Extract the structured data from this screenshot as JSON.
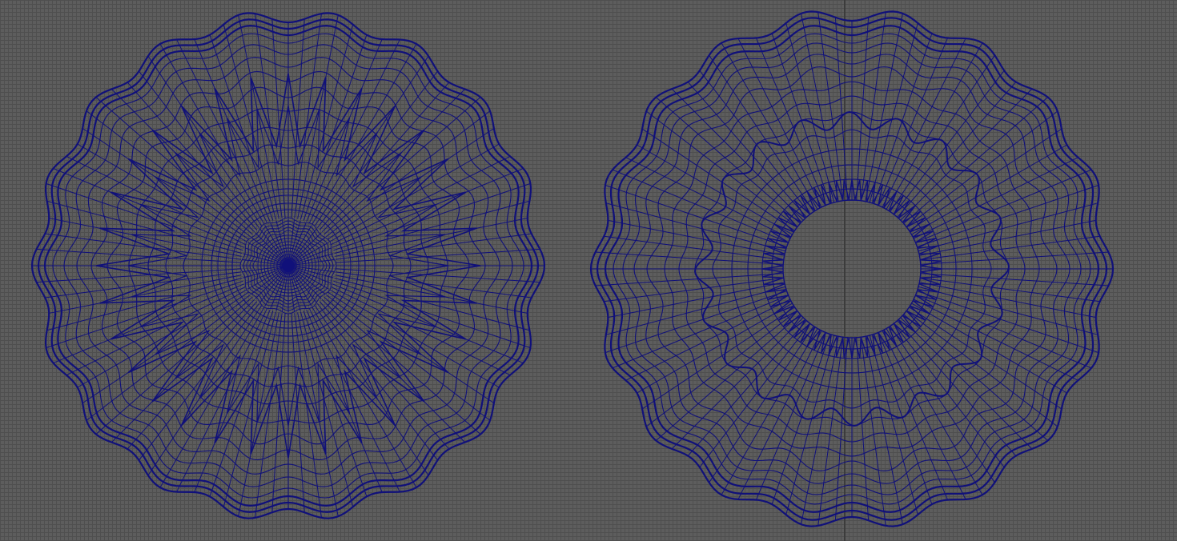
{
  "viewport": {
    "background_color": "#5d5d5d",
    "grid_line_color": "#4f4f4f",
    "axis_color": "#3c3c3c",
    "wire_color": "#10107a"
  },
  "meshes": [
    {
      "name": "left-disc",
      "kind": "filled-disc",
      "radial_spokes": 96,
      "outer_scallops": 18,
      "inner_zigzag_teeth": 32,
      "center_hub": true
    },
    {
      "name": "right-ring",
      "kind": "ring",
      "radial_spokes": 96,
      "outer_scallops": 18,
      "mid_scallops": 20,
      "inner_teeth": 72,
      "center_hub": false
    }
  ]
}
